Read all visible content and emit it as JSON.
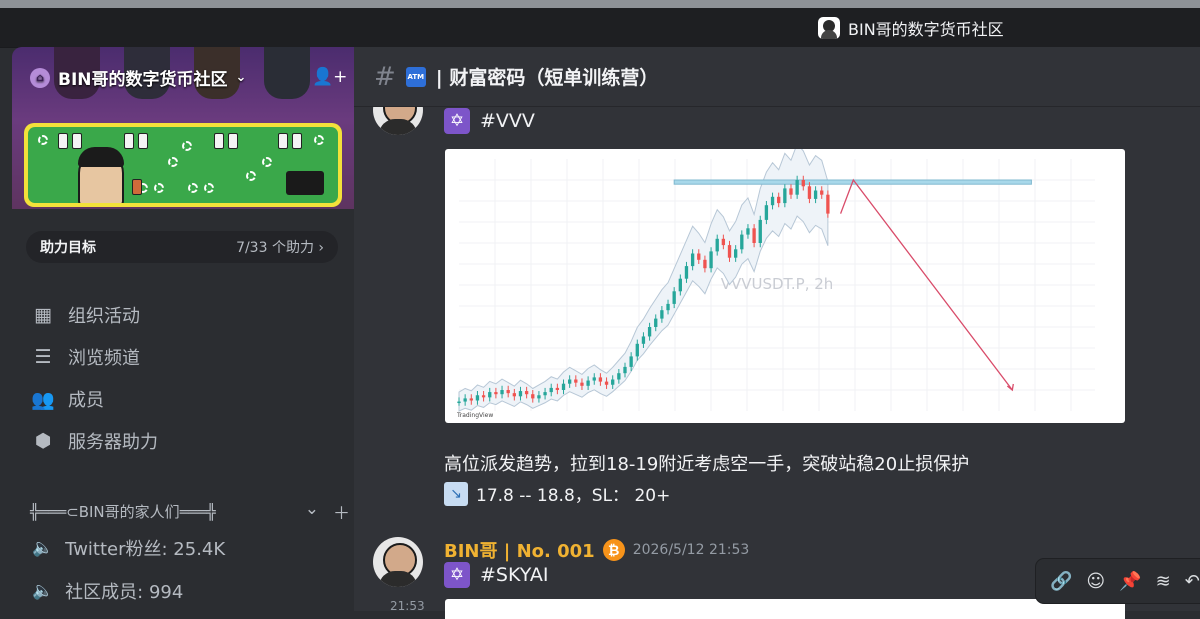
{
  "titlebar": {
    "server_label": "BIN哥的数字货币社区"
  },
  "sidebar": {
    "server_name": "BIN哥的数字货币社区",
    "boost": {
      "label": "助力目标",
      "count": "7/33 个助力 ›"
    },
    "nav": [
      {
        "label": "组织活动",
        "icon": "calendar-icon"
      },
      {
        "label": "浏览频道",
        "icon": "browse-channels-icon"
      },
      {
        "label": "成员",
        "icon": "members-icon"
      },
      {
        "label": "服务器助力",
        "icon": "boost-gem-icon"
      }
    ],
    "category": "╬═══⊂BIN哥的家人们═══╬",
    "channels": [
      {
        "label": "Twitter粉丝: 25.4K",
        "icon": "voice-locked-icon"
      },
      {
        "label": "社区成员: 994",
        "icon": "voice-locked-icon"
      }
    ]
  },
  "channel": {
    "hash": "#",
    "atm": "ATM",
    "title": "| 财富密码（短单训练营）"
  },
  "messages": [
    {
      "tag": "#VVV",
      "text": "高位派发趋势，拉到18-19附近考虑空一手，突破站稳20止损保护",
      "trade": "17.8 -- 18.8，SL： 20+"
    },
    {
      "author": "BIN哥 | No. 001",
      "timestamp": "2026/5/12 21:53",
      "tag": "#SKYAI",
      "side_time": "21:53"
    }
  ],
  "chart_data": {
    "type": "line",
    "title": "VVVUSDT.P, 2h",
    "watermark": "VVVUSDT.P, 2h",
    "footer": "TradingView",
    "series": [
      {
        "name": "",
        "values": [
          0.9,
          1.2,
          1.0,
          1.5,
          1.3,
          1.8,
          1.6,
          2.0,
          1.7,
          1.4,
          1.9,
          1.6,
          1.2,
          1.5,
          1.8,
          2.2,
          2.0,
          2.6,
          3.0,
          2.7,
          2.4,
          2.9,
          3.2,
          2.8,
          2.5,
          3.0,
          3.6,
          4.2,
          5.2,
          6.4,
          7.1,
          8.0,
          8.8,
          9.6,
          10.2,
          11.4,
          12.6,
          13.8,
          15.0,
          14.4,
          13.6,
          15.2,
          16.4,
          15.8,
          14.6,
          15.4,
          16.8,
          17.4,
          16.0,
          18.2,
          19.6,
          20.4,
          19.8,
          21.2,
          20.6,
          22.0,
          21.4,
          20.2,
          21.0,
          20.6,
          18.8
        ]
      }
    ],
    "resistance_zone": [
      21.6,
      22.0
    ],
    "projection": [
      {
        "x": 60,
        "y": 18.8
      },
      {
        "x": 62,
        "y": 22.0
      },
      {
        "x": 87,
        "y": 2.0
      }
    ],
    "ylim": [
      0,
      24
    ],
    "xlim": [
      0,
      100
    ],
    "colors": {
      "up": "#26a69a",
      "down": "#ef5350",
      "band": "#b7c7d6",
      "zone": "#a8d8ea",
      "projection": "#d94c6a"
    }
  },
  "toolbar": {
    "icons": [
      "link-icon",
      "add-reaction-icon",
      "pin-icon",
      "threads-icon",
      "reply-icon"
    ]
  }
}
